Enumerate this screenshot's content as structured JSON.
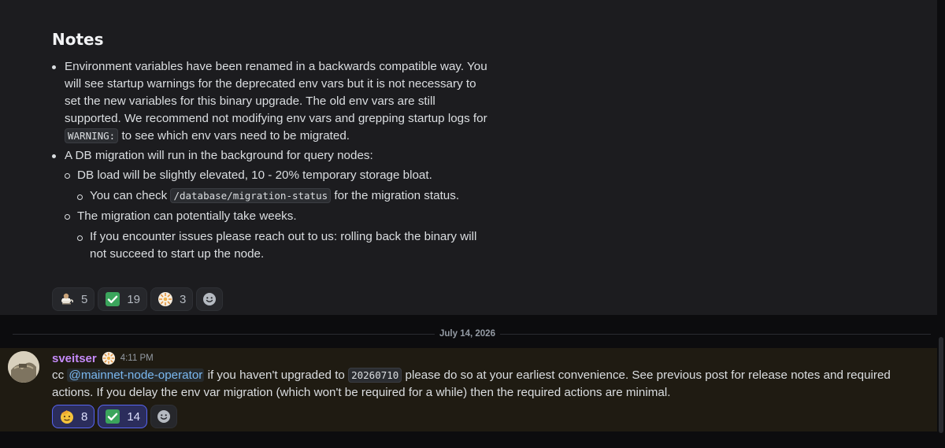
{
  "notes": {
    "title": "Notes",
    "bullet1": {
      "text_a": "Environment variables have been renamed in a backwards compatible way. You will see startup warnings for the deprecated env vars but it is not necessary to set the new variables for this binary upgrade. The old env vars are still supported. We recommend not modifying env vars and grepping startup logs for ",
      "code": "WARNING:",
      "text_b": " to see which env vars need to be migrated."
    },
    "bullet2": {
      "text": "A DB migration will run in the background for query nodes:",
      "sub1": {
        "text": "DB load will be slightly elevated, 10 - 20% temporary storage bloat.",
        "sub": {
          "text_a": "You can check ",
          "code": "/database/migration-status",
          "text_b": " for the migration status."
        }
      },
      "sub2": {
        "text": "The migration can potentially take weeks.",
        "sub": {
          "text": "If you encounter issues please reach out to us: rolling back the binary will not succeed to start up the node."
        }
      }
    }
  },
  "top_reactions": [
    {
      "emoji": "teacup-dog-icon",
      "count": "5"
    },
    {
      "emoji": "check-mark-icon",
      "count": "19"
    },
    {
      "emoji": "sun-logo-icon",
      "count": "3"
    }
  ],
  "date_divider": "July 14, 2026",
  "message": {
    "username": "sveitser",
    "timestamp": "4:11 PM",
    "text_a": "cc ",
    "mention": "@mainnet-node-operator",
    "text_b": " if you haven't upgraded to ",
    "code": "20260710",
    "text_c": " please do so at your earliest convenience. See previous post for release notes and required actions. If you delay the env var migration (which won't be required for a while) then the required actions are minimal."
  },
  "bottom_reactions": [
    {
      "emoji": "saluting-face-icon",
      "count": "8"
    },
    {
      "emoji": "check-mark-icon",
      "count": "14"
    }
  ],
  "colors": {
    "username": "#c58af9",
    "mention": "#7ab8f0",
    "check": "#3ba55c",
    "highlight_bg": "#1f1b12"
  }
}
